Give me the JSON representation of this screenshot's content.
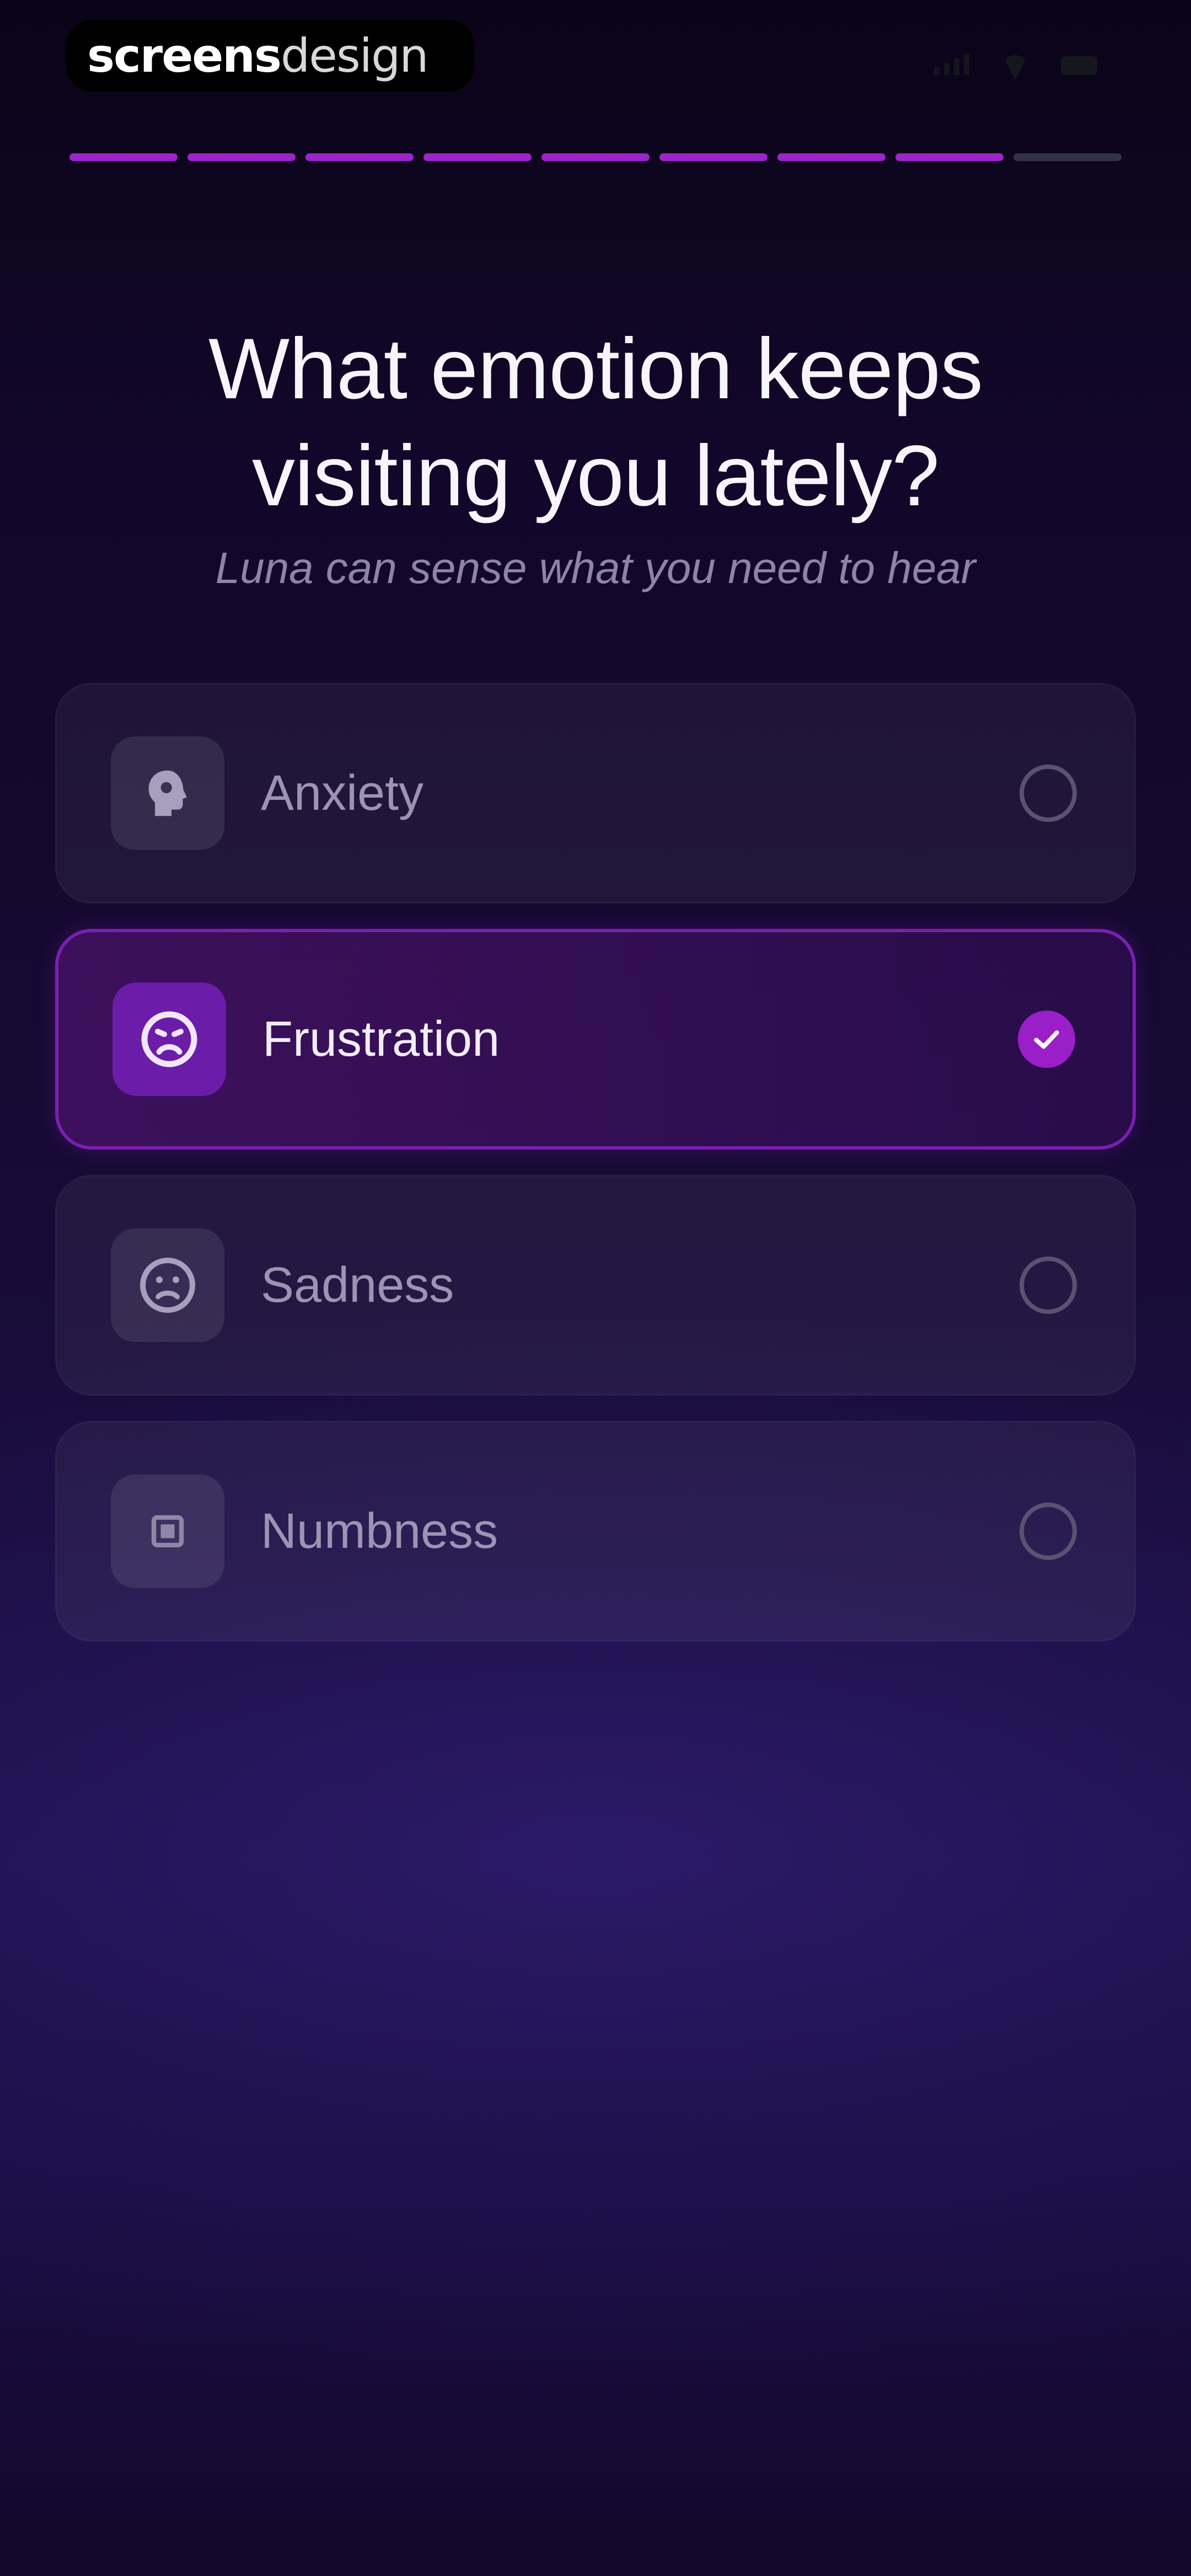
{
  "brand": {
    "strong": "screens",
    "light": "design"
  },
  "progress": {
    "total_steps": 9,
    "completed_steps": 8,
    "accent": "#9c24c9"
  },
  "question": {
    "title_line1": "What emotion keeps",
    "title_line2": "visiting you lately?",
    "subtitle": "Luna can sense what you need to hear"
  },
  "options": [
    {
      "label": "Anxiety",
      "icon": "brain-head-icon",
      "selected": false
    },
    {
      "label": "Frustration",
      "icon": "frown-face-icon",
      "selected": true
    },
    {
      "label": "Sadness",
      "icon": "sad-face-icon",
      "selected": false
    },
    {
      "label": "Numbness",
      "icon": "square-icon",
      "selected": false
    }
  ]
}
